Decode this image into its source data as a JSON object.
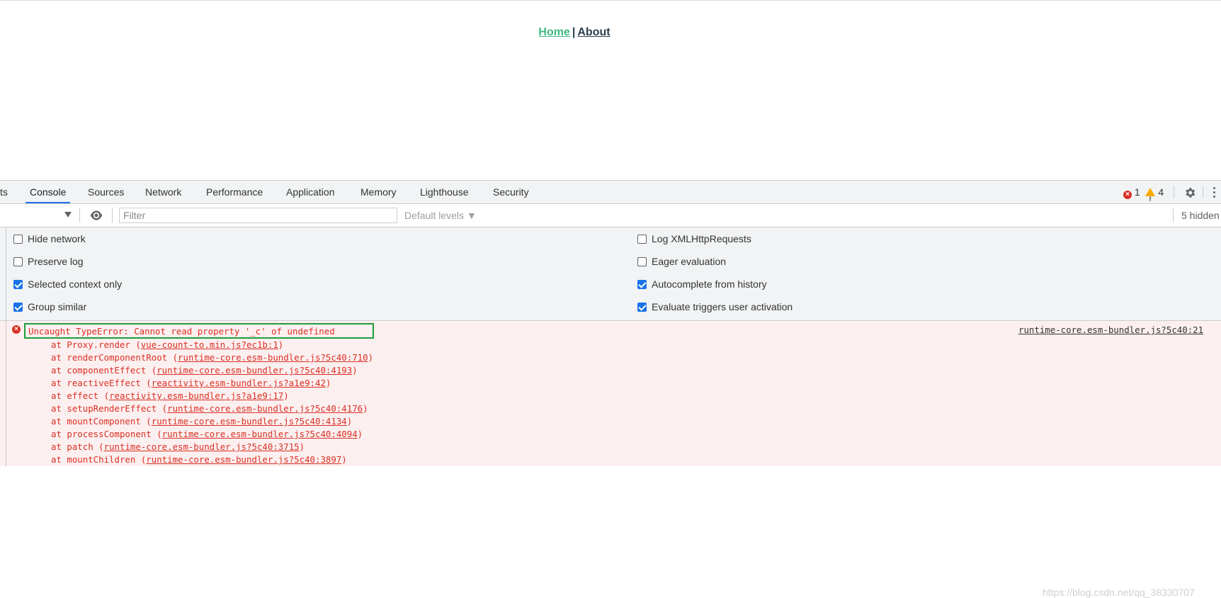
{
  "page": {
    "nav": {
      "home": "Home",
      "separator": "|",
      "about": "About"
    },
    "colors": {
      "home_link": "#42b983",
      "about_link": "#2c3e50"
    }
  },
  "devtools": {
    "tabs": [
      {
        "label": "ts"
      },
      {
        "label": "Console"
      },
      {
        "label": "Sources"
      },
      {
        "label": "Network"
      },
      {
        "label": "Performance"
      },
      {
        "label": "Application"
      },
      {
        "label": "Memory"
      },
      {
        "label": "Lighthouse"
      },
      {
        "label": "Security"
      }
    ],
    "active_tab": "Console",
    "issues": {
      "errors": "1",
      "warnings": "4"
    },
    "toolbar": {
      "filter_placeholder": "Filter",
      "levels_label": "Default levels",
      "hidden_label": "5 hidden"
    },
    "settings": {
      "left": [
        {
          "label": "Hide network",
          "checked": false
        },
        {
          "label": "Preserve log",
          "checked": false
        },
        {
          "label": "Selected context only",
          "checked": true
        },
        {
          "label": "Group similar",
          "checked": true
        }
      ],
      "right": [
        {
          "label": "Log XMLHttpRequests",
          "checked": false
        },
        {
          "label": "Eager evaluation",
          "checked": false
        },
        {
          "label": "Autocomplete from history",
          "checked": true
        },
        {
          "label": "Evaluate triggers user activation",
          "checked": true
        }
      ]
    },
    "console": {
      "error_message": "Uncaught TypeError: Cannot read property '_c' of undefined",
      "error_source": "runtime-core.esm-bundler.js?5c40:21",
      "stack": [
        {
          "prefix": "at Proxy.render (",
          "loc": "vue-count-to.min.js?ec1b:1",
          "suffix": ")"
        },
        {
          "prefix": "at renderComponentRoot (",
          "loc": "runtime-core.esm-bundler.js?5c40:710",
          "suffix": ")"
        },
        {
          "prefix": "at componentEffect (",
          "loc": "runtime-core.esm-bundler.js?5c40:4193",
          "suffix": ")"
        },
        {
          "prefix": "at reactiveEffect (",
          "loc": "reactivity.esm-bundler.js?a1e9:42",
          "suffix": ")"
        },
        {
          "prefix": "at effect (",
          "loc": "reactivity.esm-bundler.js?a1e9:17",
          "suffix": ")"
        },
        {
          "prefix": "at setupRenderEffect (",
          "loc": "runtime-core.esm-bundler.js?5c40:4176",
          "suffix": ")"
        },
        {
          "prefix": "at mountComponent (",
          "loc": "runtime-core.esm-bundler.js?5c40:4134",
          "suffix": ")"
        },
        {
          "prefix": "at processComponent (",
          "loc": "runtime-core.esm-bundler.js?5c40:4094",
          "suffix": ")"
        },
        {
          "prefix": "at patch (",
          "loc": "runtime-core.esm-bundler.js?5c40:3715",
          "suffix": ")"
        },
        {
          "prefix": "at mountChildren (",
          "loc": "runtime-core.esm-bundler.js?5c40:3897",
          "suffix": ")"
        }
      ],
      "watermark": "https://blog.csdn.net/qq_38330707"
    },
    "colors": {
      "accent": "#1a73e8",
      "error": "#d93025",
      "warning": "#f9ab00",
      "error_bg": "#fcefef",
      "highlight_box": "#1e9e3a"
    }
  }
}
